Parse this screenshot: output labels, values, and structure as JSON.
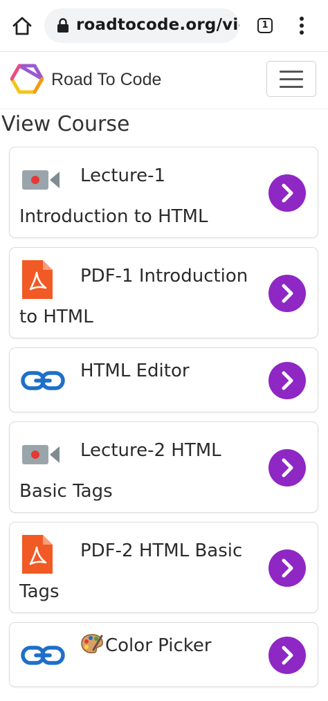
{
  "browser": {
    "url": "roadtocode.org/view",
    "tab_count": "1"
  },
  "nav": {
    "brand": "Road To Code"
  },
  "page": {
    "title": "View Course"
  },
  "items": [
    {
      "type": "video",
      "icon": "video-camera-icon",
      "title": "Lecture-1 Introduction to HTML"
    },
    {
      "type": "pdf",
      "icon": "pdf-file-icon",
      "title": "PDF-1 Introduction to HTML"
    },
    {
      "type": "link",
      "icon": "chain-link-icon",
      "title": "HTML Editor"
    },
    {
      "type": "video",
      "icon": "video-camera-icon",
      "title": "Lecture-2 HTML Basic Tags"
    },
    {
      "type": "pdf",
      "icon": "pdf-file-icon",
      "title": "PDF-2 HTML Basic Tags"
    },
    {
      "type": "link",
      "icon": "chain-link-icon",
      "title": "Color Picker",
      "prefix_icon": "artist-palette-icon"
    }
  ],
  "colors": {
    "accent_purple": "#8e27c4",
    "pdf_red": "#f15a24",
    "link_blue": "#1e6fc9",
    "camera_gray": "#9aa5ab",
    "record_red": "#e53935"
  }
}
